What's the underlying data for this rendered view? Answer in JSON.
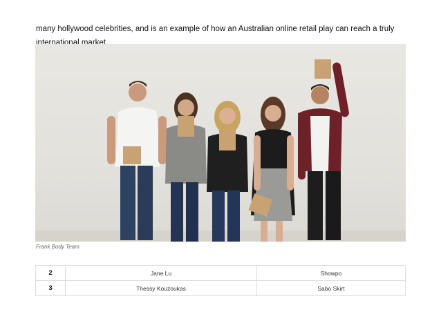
{
  "article": {
    "paragraph": "many hollywood celebrities, and is an example of how an Australian online retail play can reach a truly international market."
  },
  "figure": {
    "caption": "Frank Body Team"
  },
  "table": {
    "rows": [
      {
        "rank": "2",
        "name": "Jane Lu",
        "company": "Showpo"
      },
      {
        "rank": "3",
        "name": "Thessy Kouzoukas",
        "company": "Sabo Skirt"
      }
    ]
  }
}
